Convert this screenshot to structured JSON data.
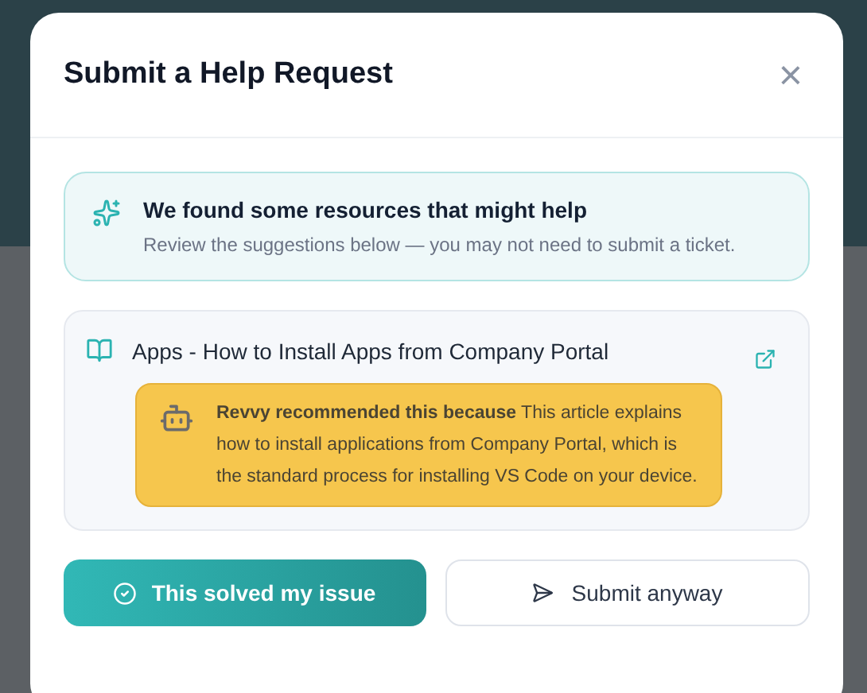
{
  "dialog": {
    "title": "Submit a Help Request",
    "close": "×"
  },
  "notice": {
    "heading": "We found some resources that might help",
    "text": "Review the suggestions below — you may not need to submit a ticket."
  },
  "articles": [
    {
      "title": "Apps - How to Install Apps from Company Portal",
      "reason": "**Revvy recommended this because** This article explains how to install applications from Company Portal, which is the standard process for installing VS Code on your device."
    }
  ],
  "buttons": [
    {
      "kind": "primary",
      "label": "This solved my issue"
    },
    {
      "kind": "secondary",
      "label": "Submit anyway"
    }
  ]
}
